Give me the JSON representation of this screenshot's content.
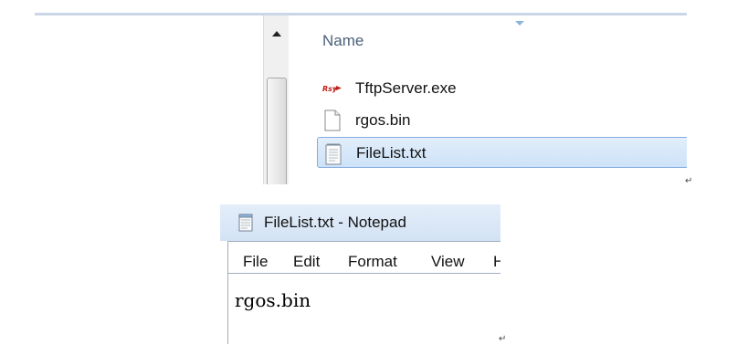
{
  "explorer": {
    "column_header": "Name",
    "files": [
      {
        "name": "TftpServer.exe",
        "icon": "tftp-exe-icon",
        "selected": false
      },
      {
        "name": "rgos.bin",
        "icon": "blank-file-icon",
        "selected": false
      },
      {
        "name": "FileList.txt",
        "icon": "text-file-icon",
        "selected": true
      }
    ]
  },
  "notepad": {
    "title": "FileList.txt - Notepad",
    "menu": [
      "File",
      "Edit",
      "Format",
      "View",
      "H"
    ],
    "content": "rgos.bin"
  },
  "colors": {
    "selection_fill": "#cde2f8",
    "selection_border": "#84acdd",
    "header_text": "#4c607a",
    "titlebar": "#dbe7f6"
  }
}
